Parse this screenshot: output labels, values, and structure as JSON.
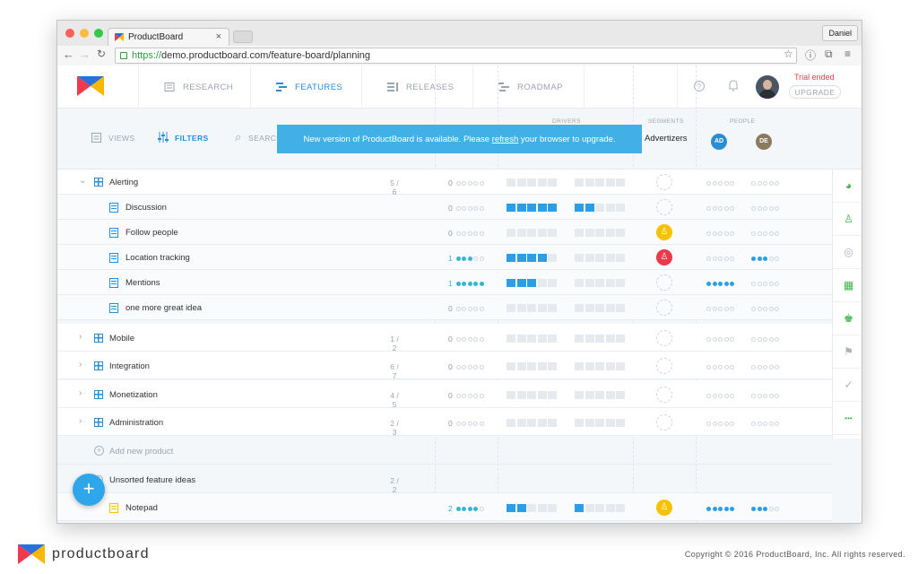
{
  "browser": {
    "tab_title": "ProductBoard",
    "tab_close": "×",
    "user": "Daniel",
    "url_scheme": "https://",
    "url_rest": "demo.productboard.com/feature-board/planning"
  },
  "topnav": {
    "items": [
      {
        "label": "RESEARCH",
        "icon": "research-icon"
      },
      {
        "label": "FEATURES",
        "icon": "features-icon"
      },
      {
        "label": "RELEASES",
        "icon": "releases-icon"
      },
      {
        "label": "ROADMAP",
        "icon": "roadmap-icon"
      }
    ],
    "trial": "Trial ended",
    "upgrade": "UPGRADE"
  },
  "toolbar": {
    "views": "VIEWS",
    "filters": "FILTERS",
    "search": "SEARCH",
    "drivers": "DRIVERS",
    "segments": "SEGMENTS",
    "people": "PEOPLE",
    "segment_name": "Advertizers",
    "people_list": [
      "AD",
      "DE"
    ]
  },
  "banner": {
    "before": "New version of ProductBoard is available. Please ",
    "link": "refresh",
    "after": " your browser to upgrade."
  },
  "rows": [
    {
      "type": "group",
      "label": "Alerting",
      "count": "5 / 6",
      "score": "0",
      "dots": 0,
      "d1": 0,
      "d2": 0,
      "seg": "",
      "p1": 0,
      "p2": 0,
      "expanded": true
    },
    {
      "type": "feature",
      "label": "Discussion",
      "score": "0",
      "dots": 0,
      "d1": 5,
      "d2": 2,
      "seg": "",
      "p1": 0,
      "p2": 0
    },
    {
      "type": "feature",
      "label": "Follow people",
      "score": "0",
      "dots": 0,
      "d1": 0,
      "d2": 0,
      "seg": "yellow",
      "p1": 0,
      "p2": 0
    },
    {
      "type": "feature",
      "label": "Location tracking",
      "score": "1",
      "dots": 3,
      "d1": 4,
      "d2": 0,
      "seg": "red",
      "p1": 0,
      "p2": 3
    },
    {
      "type": "feature",
      "label": "Mentions",
      "score": "1",
      "dots": 5,
      "d1": 3,
      "d2": 0,
      "seg": "",
      "p1": 5,
      "p2": 0
    },
    {
      "type": "feature",
      "label": "one more great idea",
      "score": "0",
      "dots": 0,
      "d1": 0,
      "d2": 0,
      "seg": "",
      "p1": 0,
      "p2": 0
    },
    {
      "type": "group",
      "label": "Mobile",
      "count": "1 / 2",
      "score": "0",
      "dots": 0,
      "d1": 0,
      "d2": 0,
      "seg": "",
      "p1": 0,
      "p2": 0
    },
    {
      "type": "group",
      "label": "Integration",
      "count": "6 / 7",
      "score": "0",
      "dots": 0,
      "d1": 0,
      "d2": 0,
      "seg": "",
      "p1": 0,
      "p2": 0
    },
    {
      "type": "group",
      "label": "Monetization",
      "count": "4 / 5",
      "score": "0",
      "dots": 0,
      "d1": 0,
      "d2": 0,
      "seg": "",
      "p1": 0,
      "p2": 0
    },
    {
      "type": "group",
      "label": "Administration",
      "count": "2 / 3",
      "score": "0",
      "dots": 0,
      "d1": 0,
      "d2": 0,
      "seg": "",
      "p1": 0,
      "p2": 0
    },
    {
      "type": "add",
      "label": "Add new product"
    },
    {
      "type": "unsorted",
      "label": "Unsorted feature ideas",
      "count": "2 / 2"
    },
    {
      "type": "notepad",
      "label": "Notepad",
      "score": "2",
      "dots": 4,
      "d1": 2,
      "d2": 1,
      "seg": "yellow",
      "p1": 5,
      "p2": 3
    }
  ],
  "rightbar": [
    "pie-icon",
    "person-icon",
    "target-icon",
    "calculator-icon",
    "trophy-icon",
    "flag-icon",
    "check-icon",
    "more-icon"
  ],
  "fab": "+",
  "footer": {
    "brand": "productboard",
    "copyright": "Copyright © 2016 ProductBoard, Inc. All rights reserved."
  },
  "colors": {
    "accent": "#2a8ed6",
    "banner": "#41b0e4",
    "yellow": "#f6c200",
    "red": "#e9394b"
  }
}
